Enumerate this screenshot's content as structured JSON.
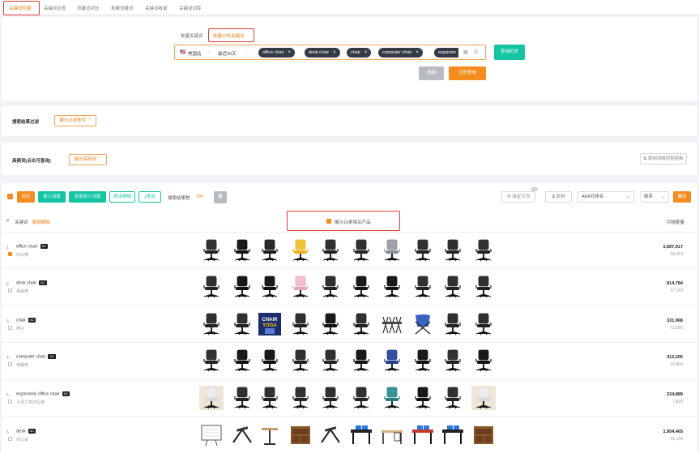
{
  "tabs": [
    "关键词挖掘",
    "关键词反查",
    "流量词对比",
    "拓展流量词",
    "关键词收录",
    "关键词词库"
  ],
  "search": {
    "mode_tabs": [
      "批量关键词",
      "批量分析关键词"
    ],
    "country": "美国站",
    "period": "最近30天",
    "chips": [
      "office chair",
      "desk chair",
      "chair",
      "computer chair",
      "ergonom"
    ],
    "history_button": "查询历史",
    "clear_button": "清除",
    "query_button": "立即查询"
  },
  "filter": {
    "label": "搜索结果过滤",
    "toggle": "展示过滤条件"
  },
  "high_freq": {
    "label": "高频词(点击可查询)",
    "toggle": "展开高频词",
    "copy_button": "复制词组到剪贴板"
  },
  "toolbar": {
    "compare": "对比",
    "add_to_lib": "加入词库",
    "add_all_to_lib": "全部加入词库",
    "export_detail": "导出明细",
    "export": "导出",
    "result_count_label": "搜索结果数:",
    "result_count": "199",
    "custom_columns": "自定义列",
    "badge": "13",
    "copy": "复制",
    "aba_select": "ABA月排名",
    "order_select": "降序",
    "confirm": "确定"
  },
  "table": {
    "col_index": "#",
    "col_keyword": "关键词",
    "col_keyword_sub": "数据解释",
    "show_products_label": "展示10条相关产品",
    "col_volume": "月搜索量",
    "rows": [
      {
        "index": "1",
        "keyword": "office chair",
        "badge": "AC",
        "translation": "办公椅",
        "checked": true,
        "volume": "1,687,917",
        "sub": "56,264",
        "thumbs": [
          "mesh-chair",
          "exec-chair",
          "gaming-chair",
          "yellow-chair",
          "mesh-chair",
          "mesh-chair",
          "gray-chair",
          "mesh-chair",
          "mesh-chair",
          "mesh-chair"
        ]
      },
      {
        "index": "2",
        "keyword": "desk chair",
        "badge": "AC",
        "translation": "课桌椅",
        "checked": false,
        "volume": "814,784",
        "sub": "27,159",
        "thumbs": [
          "mesh-chair",
          "exec-chair",
          "exec-chair",
          "pink-chair",
          "mesh-chair",
          "exec-chair",
          "exec-chair",
          "mesh-chair",
          "mesh-chair",
          "mesh-chair"
        ]
      },
      {
        "index": "3",
        "keyword": "chair",
        "badge": "AC",
        "translation": "椅子",
        "checked": false,
        "volume": "331,968",
        "sub": "11,066",
        "thumbs": [
          "mesh-chair",
          "mesh-chair",
          "yoga-chair",
          "mesh-chair",
          "exec-chair",
          "mesh-chair",
          "folding-chairs",
          "camp-chair",
          "mesh-chair",
          "mesh-chair"
        ]
      },
      {
        "index": "4",
        "keyword": "computer chair",
        "badge": "AC",
        "translation": "电脑椅",
        "checked": false,
        "volume": "312,255",
        "sub": "10,409",
        "thumbs": [
          "mesh-chair",
          "exec-chair",
          "exec-chair",
          "mesh-chair",
          "mesh-chair",
          "exec-chair",
          "blue-chair",
          "exec-chair",
          "mesh-chair",
          "exec-chair"
        ]
      },
      {
        "index": "5",
        "keyword": "ergonomic office chair",
        "badge": "AC",
        "translation": "人体工学办公椅",
        "checked": false,
        "volume": "234,889",
        "sub": "7,830",
        "thumbs": [
          "white-chair",
          "mesh-chair",
          "mesh-chair",
          "mesh-chair",
          "mesh-chair",
          "mesh-chair",
          "teal-chair",
          "exec-chair",
          "mesh-chair",
          "white-chair"
        ]
      },
      {
        "index": "6",
        "keyword": "desk",
        "badge": "AC",
        "translation": "办公桌",
        "checked": false,
        "volume": "1,954,465",
        "sub": "65,149",
        "thumbs": [
          "whiteboard",
          "laptop-stand",
          "side-table",
          "wood-desk",
          "laptop-stand",
          "gaming-desk",
          "desk",
          "red-desk",
          "gaming-desk",
          "wood-desk"
        ]
      }
    ]
  },
  "colors": {
    "accent": "#f58d1e",
    "teal": "#14c4a3",
    "highlight": "#e03a3a"
  }
}
